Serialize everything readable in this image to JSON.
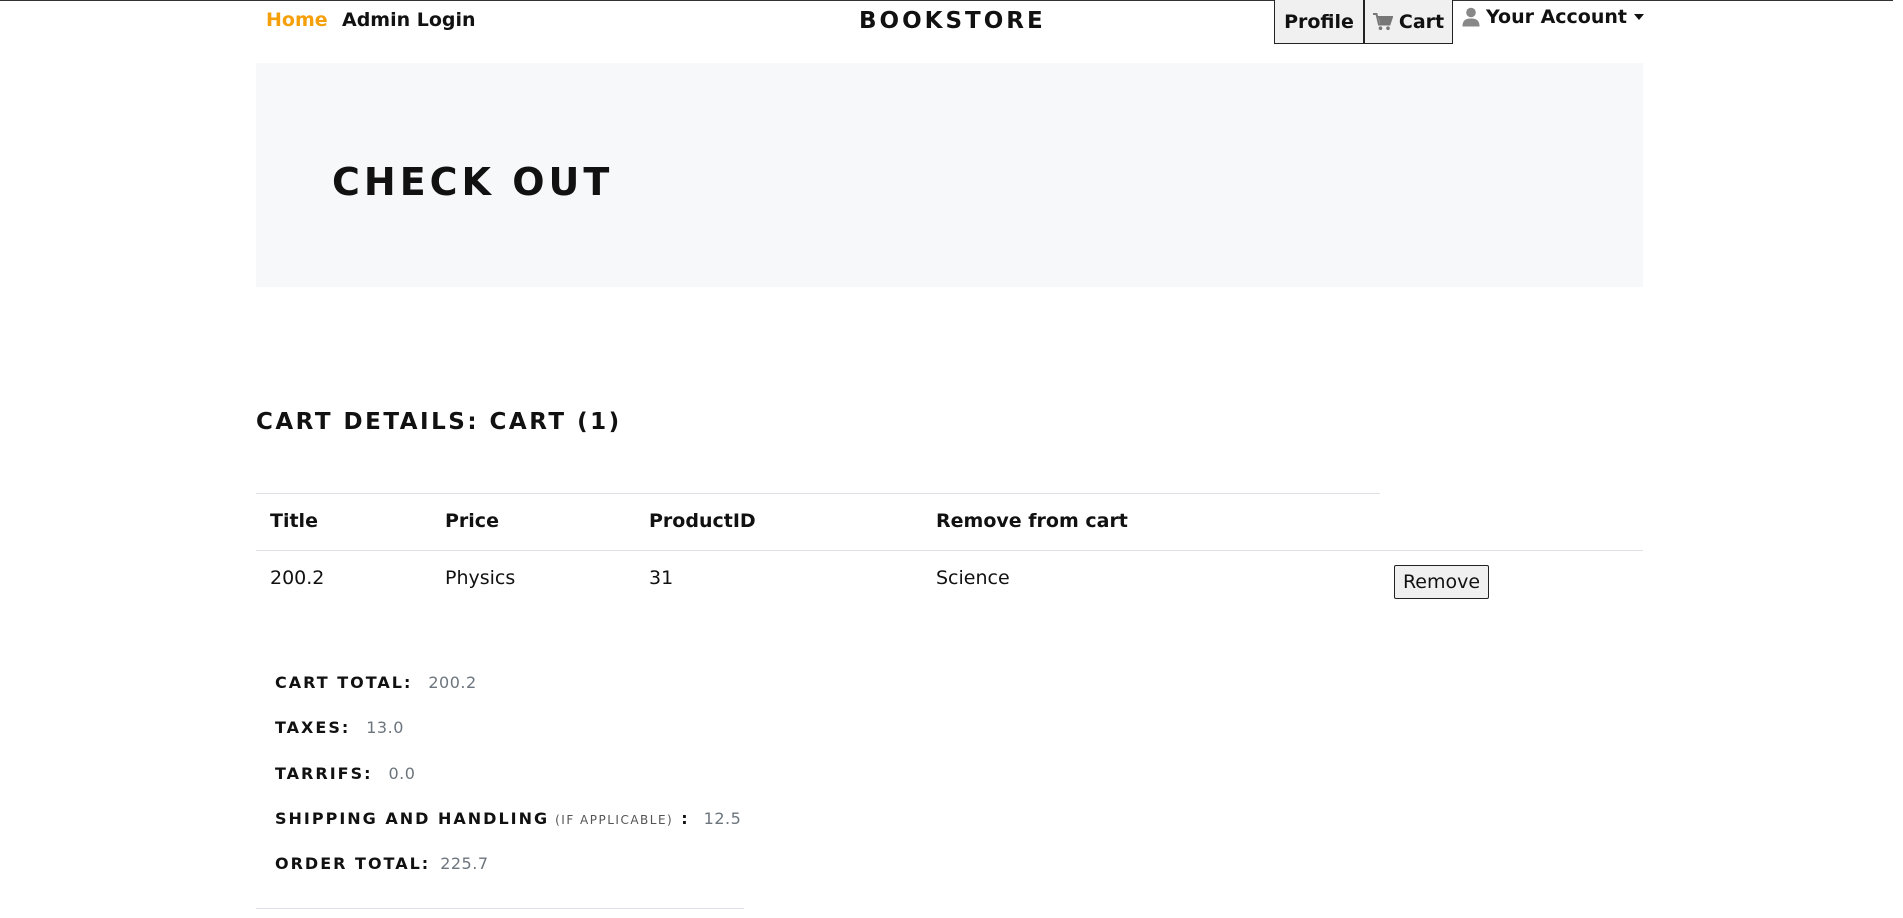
{
  "nav": {
    "home": "Home",
    "admin_login": "Admin Login",
    "brand": "BOOKSTORE",
    "profile": "Profile",
    "cart": "Cart",
    "account": "Your Account"
  },
  "hero": {
    "title": "CHECK OUT"
  },
  "cart": {
    "heading": "CART DETAILS: CART (1)",
    "columns": [
      "Title",
      "Price",
      "ProductID",
      "Remove from cart"
    ],
    "rows": [
      {
        "cells": [
          "200.2",
          "Physics",
          "31",
          "Science"
        ],
        "remove_label": "Remove"
      }
    ]
  },
  "summary": {
    "cart_total_label": "CART TOTAL:",
    "cart_total": "200.2",
    "taxes_label": "TAXES:",
    "taxes": "13.0",
    "tarrifs_label": "TARRIFS:",
    "tarrifs": "0.0",
    "shipping_label": "SHIPPING AND HANDLING",
    "shipping_note": "(IF APPLICABLE)",
    "shipping_colon": ":",
    "shipping": "12.5",
    "order_total_label": "ORDER TOTAL:",
    "order_total": "225.7"
  },
  "colors": {
    "accent": "#f5a00b",
    "jumbotron_bg": "#f7f8f9",
    "muted_value": "#6c757d"
  },
  "icons": {
    "cart": "cart-icon",
    "account": "user-icon",
    "dropdown": "caret-down-icon"
  }
}
